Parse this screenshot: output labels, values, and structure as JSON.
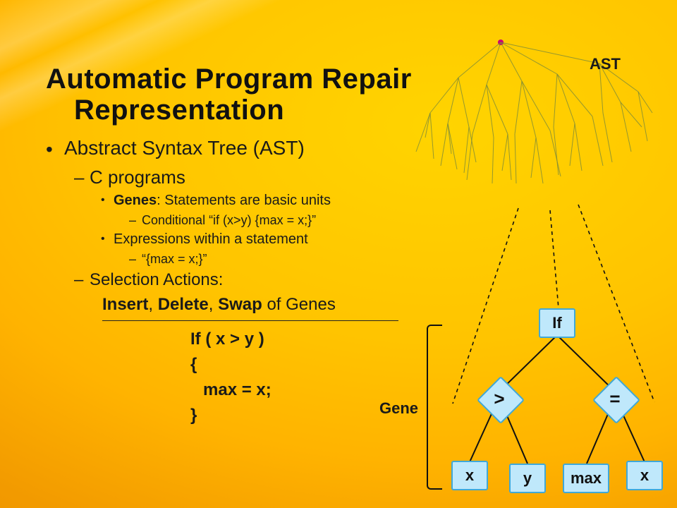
{
  "title_line1": "Automatic Program Repair",
  "title_line2": "Representation",
  "ast_label": "AST",
  "gene_label": "Gene",
  "bullets": {
    "l1": "Abstract Syntax Tree (AST)",
    "l2a": "C programs",
    "l3a_prefix": "Genes",
    "l3a_rest": ": Statements are basic units",
    "l4a": "Conditional “if (x>y) {max = x;}”",
    "l3b": "Expressions within a statement",
    "l4b": "“{max = x;}”",
    "l2b": "Selection Actions:",
    "act_insert": "Insert",
    "act_delete": "Delete",
    "act_swap": "Swap",
    "act_tail": " of Genes"
  },
  "code": {
    "l1": "If ( x > y )",
    "l2": "{",
    "l3": "max = x;",
    "l4": "}"
  },
  "tree": {
    "root": "If",
    "op_left": ">",
    "op_right": "=",
    "leaf1": "x",
    "leaf2": "y",
    "leaf3": "max",
    "leaf4": "x"
  }
}
